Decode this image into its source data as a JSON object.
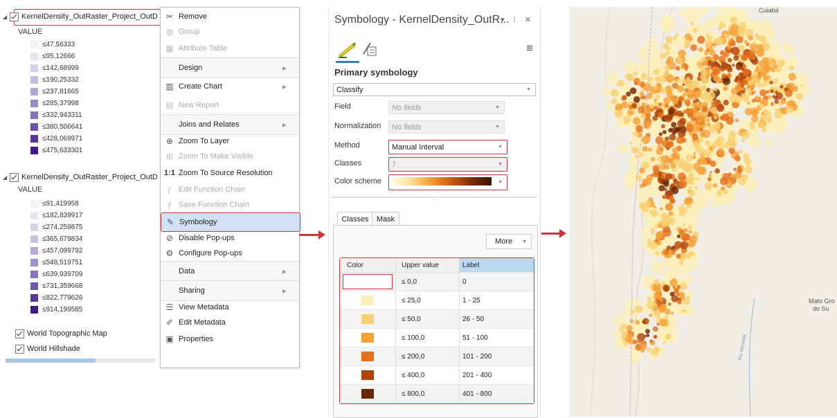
{
  "toc": {
    "layer1": {
      "name": "KernelDensity_OutRaster_Project_OutD",
      "checked": true,
      "value_header": "VALUE",
      "classes": [
        {
          "label": "≤47,56333",
          "color": "#f2f0f6"
        },
        {
          "label": "≤95,12666",
          "color": "#e5e1ef"
        },
        {
          "label": "≤142,68999",
          "color": "#d6d0e7"
        },
        {
          "label": "≤190,25332",
          "color": "#c6bddd"
        },
        {
          "label": "≤237,81665",
          "color": "#b2a5d2"
        },
        {
          "label": "≤285,37998",
          "color": "#9c8bc4"
        },
        {
          "label": "≤332,943311",
          "color": "#8672b6"
        },
        {
          "label": "≤380,506641",
          "color": "#6e53a5"
        },
        {
          "label": "≤428,069971",
          "color": "#563594"
        },
        {
          "label": "≤475,633301",
          "color": "#3f1c83"
        }
      ]
    },
    "layer2": {
      "name": "KernelDensity_OutRaster_Project_OutD",
      "checked": true,
      "value_header": "VALUE",
      "classes": [
        {
          "label": "≤91,419958",
          "color": "#f4f2f8"
        },
        {
          "label": "≤182,839917",
          "color": "#e8e5f1"
        },
        {
          "label": "≤274,259875",
          "color": "#d9d3e9"
        },
        {
          "label": "≤365,679834",
          "color": "#c9c1df"
        },
        {
          "label": "≤457,099792",
          "color": "#b6aad5"
        },
        {
          "label": "≤548,519751",
          "color": "#a091c7"
        },
        {
          "label": "≤639,939709",
          "color": "#8975b8"
        },
        {
          "label": "≤731,359668",
          "color": "#7058a7"
        },
        {
          "label": "≤822,779626",
          "color": "#573995"
        },
        {
          "label": "≤914,199585",
          "color": "#3f1c83"
        }
      ]
    },
    "basemaps": [
      {
        "name": "World Topographic Map",
        "checked": true
      },
      {
        "name": "World Hillshade",
        "checked": true
      }
    ]
  },
  "context_menu": {
    "items": [
      {
        "label": "Remove",
        "icon": "remove-layer-icon",
        "glyph": "✂",
        "disabled": false,
        "submenu": false,
        "sep": false
      },
      {
        "label": "Group",
        "icon": "group-icon",
        "glyph": "◍",
        "disabled": true,
        "submenu": false,
        "sep": false
      },
      {
        "label": "Attribute Table",
        "icon": "attribute-table-icon",
        "glyph": "▦",
        "disabled": true,
        "submenu": false,
        "sep": false
      },
      {
        "label": "Design",
        "icon": "",
        "glyph": "",
        "disabled": false,
        "submenu": true,
        "sep": true
      },
      {
        "label": "Create Chart",
        "icon": "chart-icon",
        "glyph": "▥",
        "disabled": false,
        "submenu": true,
        "sep": false
      },
      {
        "label": "New Report",
        "icon": "report-icon",
        "glyph": "▤",
        "disabled": true,
        "submenu": false,
        "sep": false
      },
      {
        "label": "Joins and Relates",
        "icon": "",
        "glyph": "",
        "disabled": false,
        "submenu": true,
        "sep": true
      },
      {
        "label": "Zoom To Layer",
        "icon": "zoom-layer-icon",
        "glyph": "⊕",
        "disabled": false,
        "submenu": false,
        "sep": false
      },
      {
        "label": "Zoom To Make Visible",
        "icon": "zoom-visible-icon",
        "glyph": "⊞",
        "disabled": true,
        "submenu": false,
        "sep": false
      },
      {
        "label": "Zoom To Source Resolution",
        "icon": "source-resolution-icon",
        "glyph": "1:1",
        "disabled": false,
        "submenu": false,
        "sep": false
      },
      {
        "label": "Edit Function Chain",
        "icon": "function-chain-icon",
        "glyph": "ƒ",
        "disabled": true,
        "submenu": false,
        "sep": false
      },
      {
        "label": "Save Function Chain",
        "icon": "save-chain-icon",
        "glyph": "ƒ",
        "disabled": true,
        "submenu": false,
        "sep": false
      },
      {
        "label": "Symbology",
        "icon": "symbology-icon",
        "glyph": "✎",
        "disabled": false,
        "submenu": false,
        "sep": false,
        "selected": true
      },
      {
        "label": "Disable Pop-ups",
        "icon": "disable-popups-icon",
        "glyph": "⊘",
        "disabled": false,
        "submenu": false,
        "sep": false
      },
      {
        "label": "Configure Pop-ups",
        "icon": "configure-popups-icon",
        "glyph": "⚙",
        "disabled": false,
        "submenu": false,
        "sep": false
      },
      {
        "label": "Data",
        "icon": "",
        "glyph": "",
        "disabled": false,
        "submenu": true,
        "sep": true
      },
      {
        "label": "Sharing",
        "icon": "",
        "glyph": "",
        "disabled": false,
        "submenu": true,
        "sep": true
      },
      {
        "label": "View Metadata",
        "icon": "view-metadata-icon",
        "glyph": "☰",
        "disabled": false,
        "submenu": false,
        "sep": false
      },
      {
        "label": "Edit Metadata",
        "icon": "edit-metadata-icon",
        "glyph": "✐",
        "disabled": false,
        "submenu": false,
        "sep": false
      },
      {
        "label": "Properties",
        "icon": "properties-icon",
        "glyph": "▣",
        "disabled": false,
        "submenu": false,
        "sep": false
      }
    ]
  },
  "symbology": {
    "title": "Symbology - KernelDensity_OutR...",
    "pin_controls": "▾ ⁞ ✕",
    "primary_title": "Primary symbology",
    "renderer": "Classify",
    "field_label": "Field",
    "field_value": "No fields",
    "normalization_label": "Normalization",
    "normalization_value": "No fields",
    "method_label": "Method",
    "method_value": "Manual Interval",
    "classes_label": "Classes",
    "classes_value": "7",
    "color_scheme_label": "Color scheme",
    "tabs": [
      "Classes",
      "Mask"
    ],
    "more_label": "More",
    "table": {
      "headers": [
        "Color",
        "Upper value",
        "Label"
      ],
      "rows": [
        {
          "color": "#ffffff",
          "upper": "≤  0,0",
          "label": "0"
        },
        {
          "color": "#fdeeb8",
          "upper": "≤  25,0",
          "label": "1 - 25"
        },
        {
          "color": "#f9cf72",
          "upper": "≤  50,0",
          "label": "26 - 50"
        },
        {
          "color": "#f5a13a",
          "upper": "≤  100,0",
          "label": "51 - 100"
        },
        {
          "color": "#e3701a",
          "upper": "≤  200,0",
          "label": "101 - 200"
        },
        {
          "color": "#b24409",
          "upper": "≤  400,0",
          "label": "201 - 400"
        },
        {
          "color": "#6b2406",
          "upper": "≤  800,0",
          "label": "401 - 800"
        }
      ]
    }
  },
  "map": {
    "labels": [
      "Cuiabá",
      "Mato Gro",
      "do Su",
      "Rio Miranda"
    ]
  }
}
